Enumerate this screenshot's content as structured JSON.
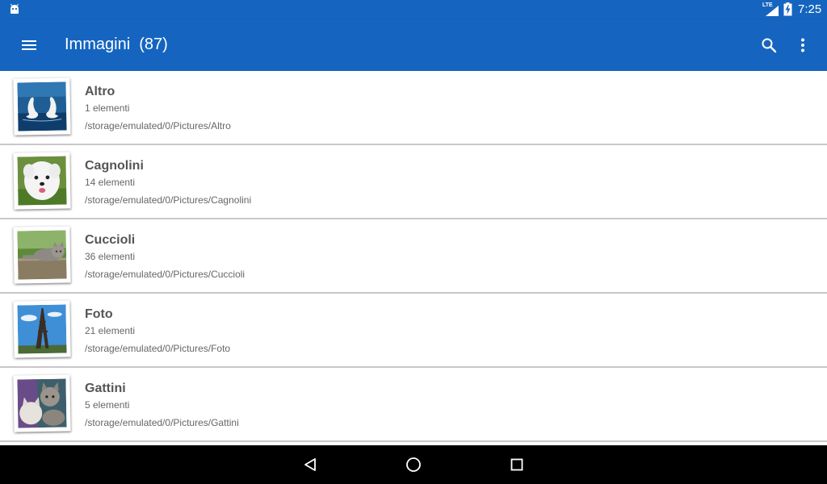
{
  "status_bar": {
    "network_label": "LTE",
    "time": "7:25"
  },
  "app_bar": {
    "title": "Immagini  (87)",
    "color": "#1565c0"
  },
  "albums": [
    {
      "name": "Altro",
      "count": "1 elementi",
      "path": "/storage/emulated/0/Pictures/Altro",
      "thumbnail": "swans"
    },
    {
      "name": "Cagnolini",
      "count": "14 elementi",
      "path": "/storage/emulated/0/Pictures/Cagnolini",
      "thumbnail": "white-puppy"
    },
    {
      "name": "Cuccioli",
      "count": "36 elementi",
      "path": "/storage/emulated/0/Pictures/Cuccioli",
      "thumbnail": "cat-on-ledge"
    },
    {
      "name": "Foto",
      "count": "21 elementi",
      "path": "/storage/emulated/0/Pictures/Foto",
      "thumbnail": "eiffel-tower"
    },
    {
      "name": "Gattini",
      "count": "5 elementi",
      "path": "/storage/emulated/0/Pictures/Gattini",
      "thumbnail": "kittens"
    }
  ],
  "icons": {
    "menu": "hamburger-menu-icon",
    "search": "search-icon",
    "more": "more-vert-icon",
    "back": "back-icon",
    "home": "home-icon",
    "recents": "recents-icon"
  }
}
